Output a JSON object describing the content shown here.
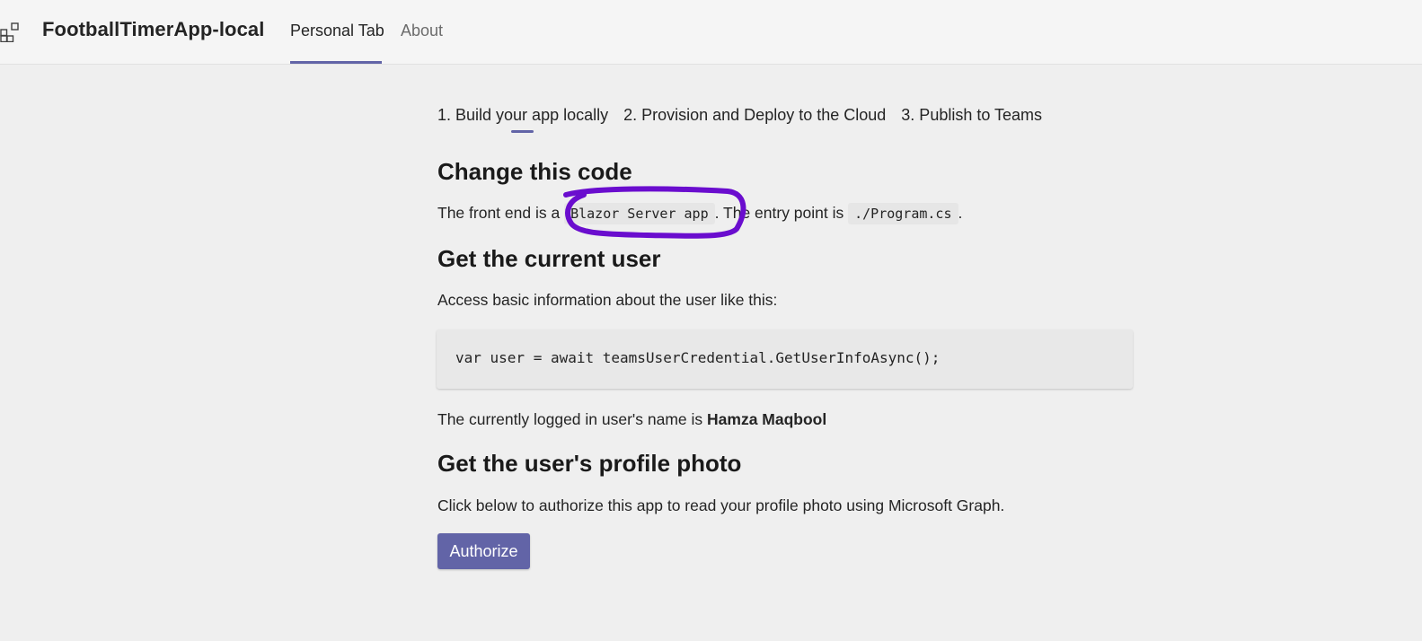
{
  "header": {
    "app_title": "FootballTimerApp-local",
    "tabs": [
      {
        "label": "Personal Tab",
        "active": true
      },
      {
        "label": "About",
        "active": false
      }
    ],
    "accent_color": "#6264a7"
  },
  "steps": [
    {
      "label": "1. Build your app locally",
      "active": true
    },
    {
      "label": "2. Provision and Deploy to the Cloud",
      "active": false
    },
    {
      "label": "3. Publish to Teams",
      "active": false
    }
  ],
  "section_change": {
    "heading": "Change this code",
    "text_before": "The front end is a",
    "code1": "Blazor Server app",
    "text_middle": ". The entry point is",
    "code2": "./Program.cs",
    "text_after": "."
  },
  "section_user": {
    "heading": "Get the current user",
    "intro": "Access basic information about the user like this:",
    "code": "var user = await teamsUserCredential.GetUserInfoAsync();",
    "logged_in_prefix": "The currently logged in user's name is",
    "user_name": "Hamza Maqbool"
  },
  "section_photo": {
    "heading": "Get the user's profile photo",
    "intro": "Click below to authorize this app to read your profile photo using Microsoft Graph.",
    "button_label": "Authorize"
  },
  "annotation": {
    "color": "#6a0dce"
  }
}
